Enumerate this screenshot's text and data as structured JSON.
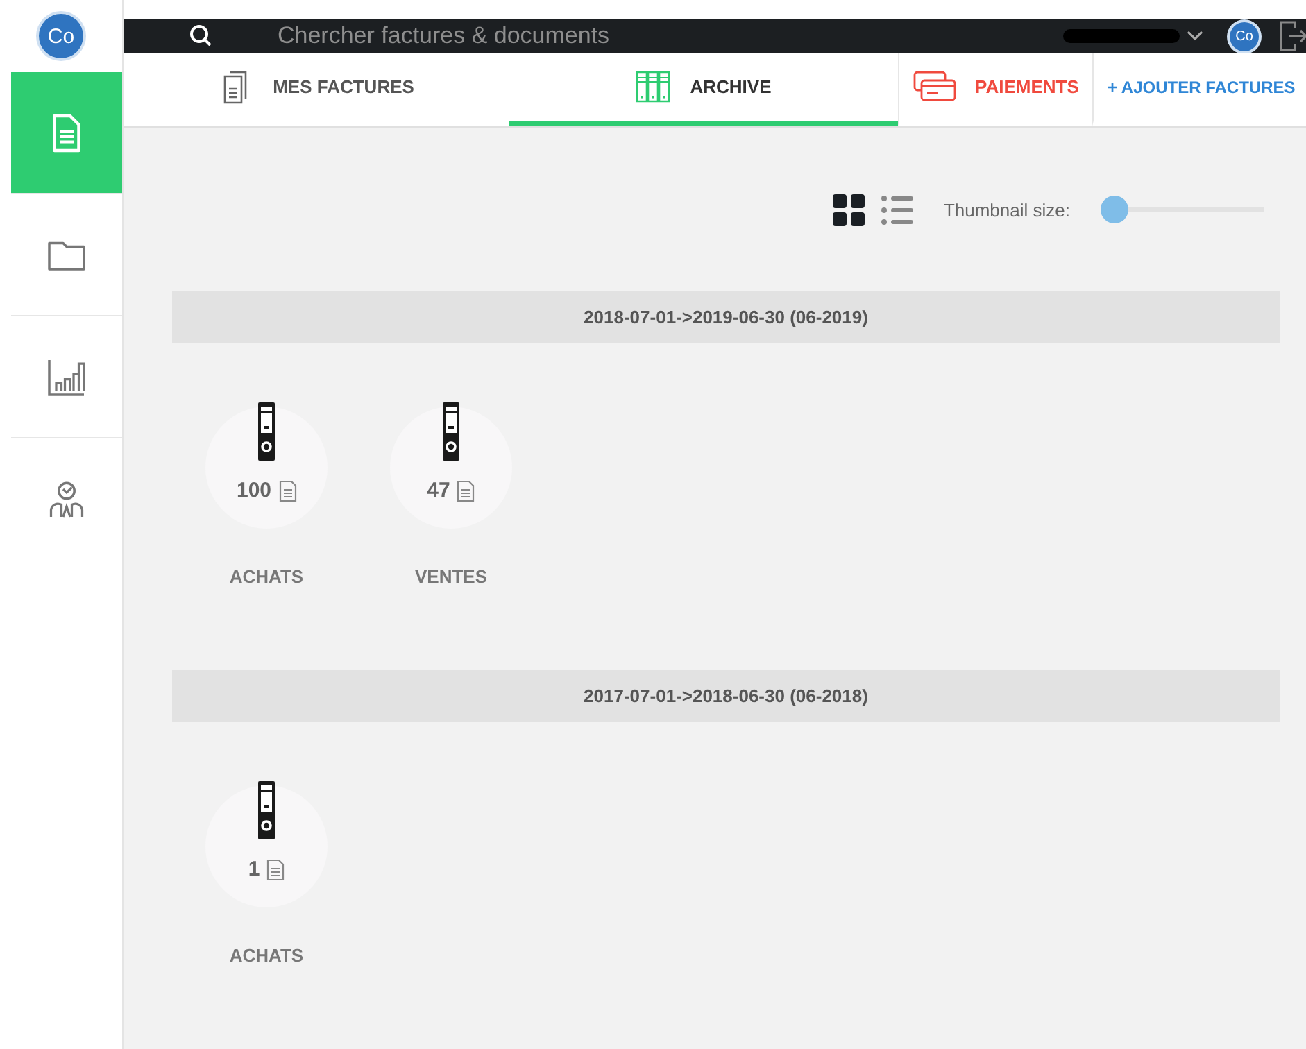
{
  "sidebar": {
    "avatar": "Co",
    "items": [
      {
        "kind": "invoices",
        "selected": true
      },
      {
        "kind": "folder",
        "selected": false
      },
      {
        "kind": "chart",
        "selected": false
      },
      {
        "kind": "user",
        "selected": false
      }
    ]
  },
  "top_bar": {
    "search": {
      "placeholder": "Chercher factures & documents"
    },
    "avatar": "Co"
  },
  "tabs": [
    {
      "kind": "documents",
      "label": "MES FACTURES",
      "selected": false,
      "color": "#555555"
    },
    {
      "kind": "archive",
      "label": "ARCHIVE",
      "selected": true,
      "color": "#333333"
    },
    {
      "kind": "payments",
      "label": "PAIEMENTS",
      "selected": false,
      "color": "#f04a3e"
    },
    {
      "kind": "action",
      "label": "+ AJOUTER FACTURES",
      "selected": false,
      "color": "#2f86d6"
    }
  ],
  "view_toggle": [
    {
      "kind": "grid",
      "selected": true
    },
    {
      "kind": "list",
      "selected": false
    }
  ],
  "thumbnail_size": {
    "label": "Thumbnail size:",
    "level": 0
  },
  "periods": [
    {
      "title": "2018-07-01->2019-06-30 (06-2019)",
      "folders": [
        {
          "count": "100",
          "label": "ACHATS"
        },
        {
          "count": "47",
          "label": "VENTES"
        }
      ]
    },
    {
      "title": "2017-07-01->2018-06-30 (06-2018)",
      "folders": [
        {
          "count": "1",
          "label": "ACHATS"
        }
      ]
    }
  ]
}
